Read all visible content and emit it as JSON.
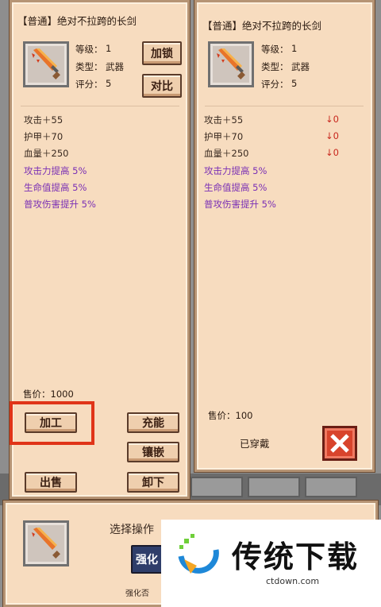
{
  "left": {
    "title": "【普通】绝对不拉跨的长剑",
    "fields": {
      "level_label": "等级：",
      "level": "1",
      "type_label": "类型：",
      "type": "武器",
      "score_label": "评分：",
      "score": "5"
    },
    "buttons": {
      "lock": "加锁",
      "compare": "对比",
      "craft": "加工",
      "charge": "充能",
      "inlay": "镶嵌",
      "sell": "出售",
      "unequip": "卸下"
    },
    "stats": [
      "攻击＋55",
      "护甲＋70",
      "血量＋250"
    ],
    "bonuses": [
      "攻击力提高 5%",
      "生命值提高 5%",
      "普攻伤害提升 5%"
    ],
    "price": "售价：1000"
  },
  "right": {
    "title": "【普通】绝对不拉跨的长剑",
    "fields": {
      "level_label": "等级：",
      "level": "1",
      "type_label": "类型：",
      "type": "武器",
      "score_label": "评分：",
      "score": "5"
    },
    "stats": [
      "攻击＋55",
      "护甲＋70",
      "血量＋250"
    ],
    "diffs": [
      "↓0",
      "↓0",
      "↓0"
    ],
    "bonuses": [
      "攻击力提高 5%",
      "生命值提高 5%",
      "普攻伤害提升 5%"
    ],
    "price": "售价：100",
    "equipped": "已穿戴"
  },
  "bottom": {
    "prompt": "选择操作",
    "skill_label": "强化",
    "skill_caption": "强化否"
  },
  "watermark": {
    "brand": "传统下载",
    "url": "ctdown.com"
  },
  "colors": {
    "highlight": "#e03418",
    "bonus": "#7a2fb5",
    "diff": "#c8281e"
  },
  "icons": {
    "item": "sword-icon",
    "close": "close-x-icon"
  }
}
